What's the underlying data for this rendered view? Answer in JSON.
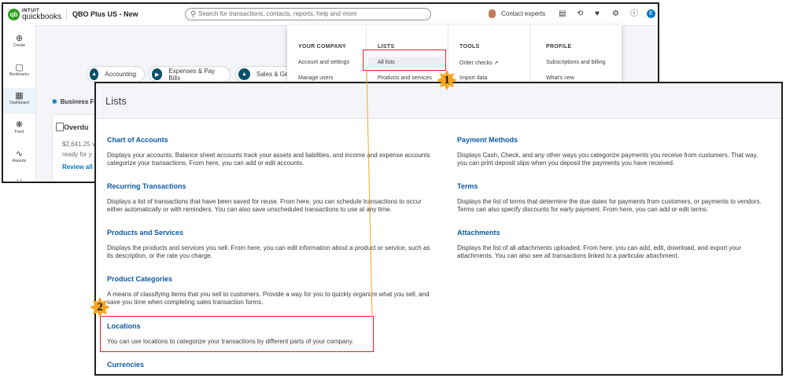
{
  "topbar": {
    "logo_top": "INTUIT",
    "logo_bottom": "quickbooks",
    "company": "QBO Plus US - New",
    "search_placeholder": "Search for transactions, contacts, reports, help and more",
    "contact_experts": "Contact experts",
    "user_initial": "E"
  },
  "sidenav": [
    {
      "label": "Create",
      "icon": "plus-circle-icon"
    },
    {
      "label": "Bookmarks",
      "icon": "bookmark-icon"
    },
    {
      "label": "Dashboard",
      "icon": "grid-icon"
    },
    {
      "label": "Feed",
      "icon": "sparkle-icon"
    },
    {
      "label": "Reports",
      "icon": "chart-icon"
    }
  ],
  "pills": [
    "Accounting",
    "Expenses & Pay Bills",
    "Sales & Get"
  ],
  "business": {
    "label": "Business Fe",
    "card_title": "Overdu",
    "amount": "$2,641.25 v",
    "ready": "ready for y",
    "link": "Review all"
  },
  "gear_menu": {
    "your_company": {
      "heading": "YOUR COMPANY",
      "items": [
        "Account and settings",
        "Manage users"
      ]
    },
    "lists": {
      "heading": "LISTS",
      "items": [
        "All lists",
        "Products and services"
      ]
    },
    "tools": {
      "heading": "TOOLS",
      "items": [
        "Order checks",
        "Import data"
      ]
    },
    "profile": {
      "heading": "PROFILE",
      "items": [
        "Subscriptions and billing",
        "What's new"
      ]
    }
  },
  "lists_page": {
    "title": "Lists",
    "left": [
      {
        "title": "Chart of Accounts",
        "desc_lines": [
          "Displays your accounts. Balance sheet accounts track your assets and liabilities, and income and expense accounts",
          "categorize your transactions. From here, you can add or edit accounts."
        ]
      },
      {
        "title": "Recurring Transactions",
        "desc_lines": [
          "Displays a list of transactions that have been saved for reuse. From here, you can schedule transactions to occur",
          "either automatically or with reminders. You can also save unscheduled transactions to use at any time."
        ]
      },
      {
        "title": "Products and Services",
        "desc_lines": [
          "Displays the products and services you sell. From here, you can edit information about a product or service, such as",
          "its description, or the rate you charge."
        ]
      },
      {
        "title": "Product Categories",
        "desc_lines": [
          "A means of classifying items that you sell to customers. Provide a way for you to quickly organize what you sell, and",
          "save you time when completing sales transaction forms."
        ]
      },
      {
        "title": "Locations",
        "desc_lines": [
          "You can use locations to categorize your transactions by different parts of your company."
        ]
      },
      {
        "title": "Currencies",
        "desc_lines": []
      }
    ],
    "right": [
      {
        "title": "Payment Methods",
        "desc_lines": [
          "Displays Cash, Check, and any other ways you categorize payments you receive from customers. That way,",
          "you can print deposit slips when you deposit the payments you have received."
        ]
      },
      {
        "title": "Terms",
        "desc_lines": [
          "Displays the list of terms that determine the due dates for payments from customers, or payments to vendors.",
          "Terms can also specify discounts for early payment. From here, you can add or edit terms."
        ]
      },
      {
        "title": "Attachments",
        "desc_lines": [
          "Displays the list of all attachments uploaded. From here, you can add, edit, download, and export your",
          "attachments. You can also see all transactions linked to a particular attachment."
        ]
      }
    ]
  },
  "annotations": {
    "step1": "1",
    "step2": "2"
  },
  "colors": {
    "brand_green": "#2ca01c",
    "link_blue": "#0e5aa7",
    "highlight_red": "#e0202a",
    "badge_orange": "#f5a623"
  }
}
